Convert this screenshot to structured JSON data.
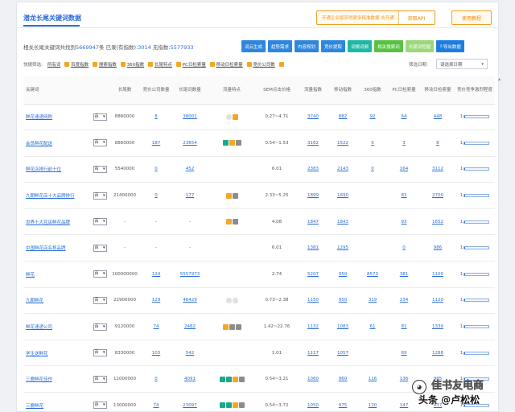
{
  "header": {
    "title": "潜龙长尾关键词数据",
    "promo_text": "开通企业版获得更多精准数据 去开通",
    "promo_button": "获取API",
    "help_button": "使用教程"
  },
  "summary": {
    "prefix": "相关长尾关键词共找到",
    "total": "5669947",
    "mid": "条 已录(有指数):",
    "indexed": "3014",
    "suffix": " 无指数:",
    "no_index": "5577933"
  },
  "toolbar": {
    "buttons": [
      "词云生成",
      "趋势需求",
      "内容规划",
      "竞价提取",
      "词根词频",
      "相关搜索词",
      "长尾词挖掘"
    ],
    "export": "导出数据"
  },
  "filters": {
    "label": "快捷筛选:",
    "items": [
      "所有词",
      "百度指数",
      "搜索指数",
      "360指数",
      "长尾特点",
      "PC日检索量",
      "移动日检索量",
      "竞价公司数"
    ],
    "date_label": "筛选日期:",
    "date_value": "请选择日期"
  },
  "table": {
    "headers": [
      "关键词",
      "",
      "长尾数",
      "竞价公司数量",
      "长尾词数量",
      "流量特点",
      "SEM点击价格",
      "流量指数",
      "移动指数",
      "360指数",
      "PC日检索量",
      "移动日检索量",
      "竞价竞争激烈程度"
    ],
    "rows": [
      {
        "kw": "鲜花速递网购",
        "se": "百",
        "longtail": "8860000",
        "companies": "8",
        "words": "38001",
        "features": [
          "dot",
          "orange"
        ],
        "sem": "0.27~4.71",
        "traffic": "3740",
        "mobile": "882",
        "i360": "92",
        "pc": "64",
        "mob_daily": "448",
        "compete": "1"
      },
      {
        "kw": "会员鲜花配送",
        "se": "百",
        "longtail": "8860000",
        "companies": "187",
        "words": "23654",
        "features": [
          "teal",
          "orange",
          "grey"
        ],
        "sem": "0.54~1.53",
        "traffic": "3162",
        "mobile": "1522",
        "i360": "0",
        "pc": "3",
        "mob_daily": "8",
        "compete": "1"
      },
      {
        "kw": "鲜花店排行前十位",
        "se": "百",
        "longtail": "5540000",
        "companies": "0",
        "words": "452",
        "features": [],
        "sem": "6.01",
        "traffic": "2383",
        "mobile": "2143",
        "i360": "0",
        "pc": "164",
        "mob_daily": "3112",
        "compete": "1"
      },
      {
        "kw": "九朝鲜花店十大品牌排行",
        "se": "百",
        "longtail": "21400000",
        "companies": "0",
        "words": "177",
        "features": [
          "orange",
          "grey"
        ],
        "sem": "2.33~5.25",
        "traffic": "1899",
        "mobile": "1690",
        "i360": "",
        "pc": "83",
        "mob_daily": "2700",
        "compete": "1"
      },
      {
        "kw": "世界十大花店鲜花品牌",
        "se": "百",
        "longtail": "-",
        "companies": "-",
        "words": "-",
        "features": [
          "orange",
          "grey"
        ],
        "sem": "4.08",
        "traffic": "1847",
        "mobile": "1843",
        "i360": "",
        "pc": "93",
        "mob_daily": "1652",
        "compete": "1"
      },
      {
        "kw": "中国鲜花店名称品牌",
        "se": "百",
        "longtail": "-",
        "companies": "-",
        "words": "-",
        "features": [],
        "sem": "6.01",
        "traffic": "1381",
        "mobile": "1295",
        "i360": "",
        "pc": "0",
        "mob_daily": "986",
        "compete": "1"
      },
      {
        "kw": "鲜花",
        "se": "百",
        "longtail": "100000000",
        "companies": "124",
        "words": "5557973",
        "features": [],
        "sem": "2.74",
        "traffic": "5207",
        "mobile": "950",
        "i360": "8573",
        "pc": "381",
        "mob_daily": "1100",
        "compete": "1"
      },
      {
        "kw": "九朝鲜花",
        "se": "百",
        "longtail": "22900000",
        "companies": "129",
        "words": "46429",
        "features": [
          "dot",
          "dot"
        ],
        "sem": "0.73~2.38",
        "traffic": "1150",
        "mobile": "950",
        "i360": "319",
        "pc": "234",
        "mob_daily": "1120",
        "compete": "1"
      },
      {
        "kw": "鲜花速递公司",
        "se": "百",
        "longtail": "9120000",
        "companies": "74",
        "words": "2482",
        "features": [
          "orange",
          "grey",
          "grey"
        ],
        "sem": "1.42~22.76",
        "traffic": "1132",
        "mobile": "1083",
        "i360": "61",
        "pc": "81",
        "mob_daily": "1339",
        "compete": "1"
      },
      {
        "kw": "学生送鲜花",
        "se": "百",
        "longtail": "8330000",
        "companies": "103",
        "words": "542",
        "features": [],
        "sem": "1.01",
        "traffic": "1117",
        "mobile": "1057",
        "i360": "",
        "pc": "69",
        "mob_daily": "1288",
        "compete": "1"
      },
      {
        "kw": "三鹿鲜花佳作",
        "se": "百",
        "longtail": "11000000",
        "companies": "0",
        "words": "4091",
        "features": [
          "teal",
          "teal",
          "orange",
          "grey"
        ],
        "sem": "0.54~3.21",
        "traffic": "1060",
        "mobile": "960",
        "i360": "116",
        "pc": "136",
        "mob_daily": "985",
        "compete": "1"
      },
      {
        "kw": "三鹿鲜花",
        "se": "百",
        "longtail": "13000000",
        "companies": "74",
        "words": "23097",
        "features": [
          "teal",
          "teal",
          "orange",
          "grey"
        ],
        "sem": "0.54~3.72",
        "traffic": "1050",
        "mobile": "975",
        "i360": "120",
        "pc": "147",
        "mob_daily": "937",
        "compete": "1"
      }
    ]
  },
  "watermark": {
    "line1": "佳书友电商",
    "line2": "头条 @卢松松"
  },
  "colors": {
    "accent": "#2a6dd6",
    "orange": "#f5a623",
    "teal": "#19a98f"
  }
}
